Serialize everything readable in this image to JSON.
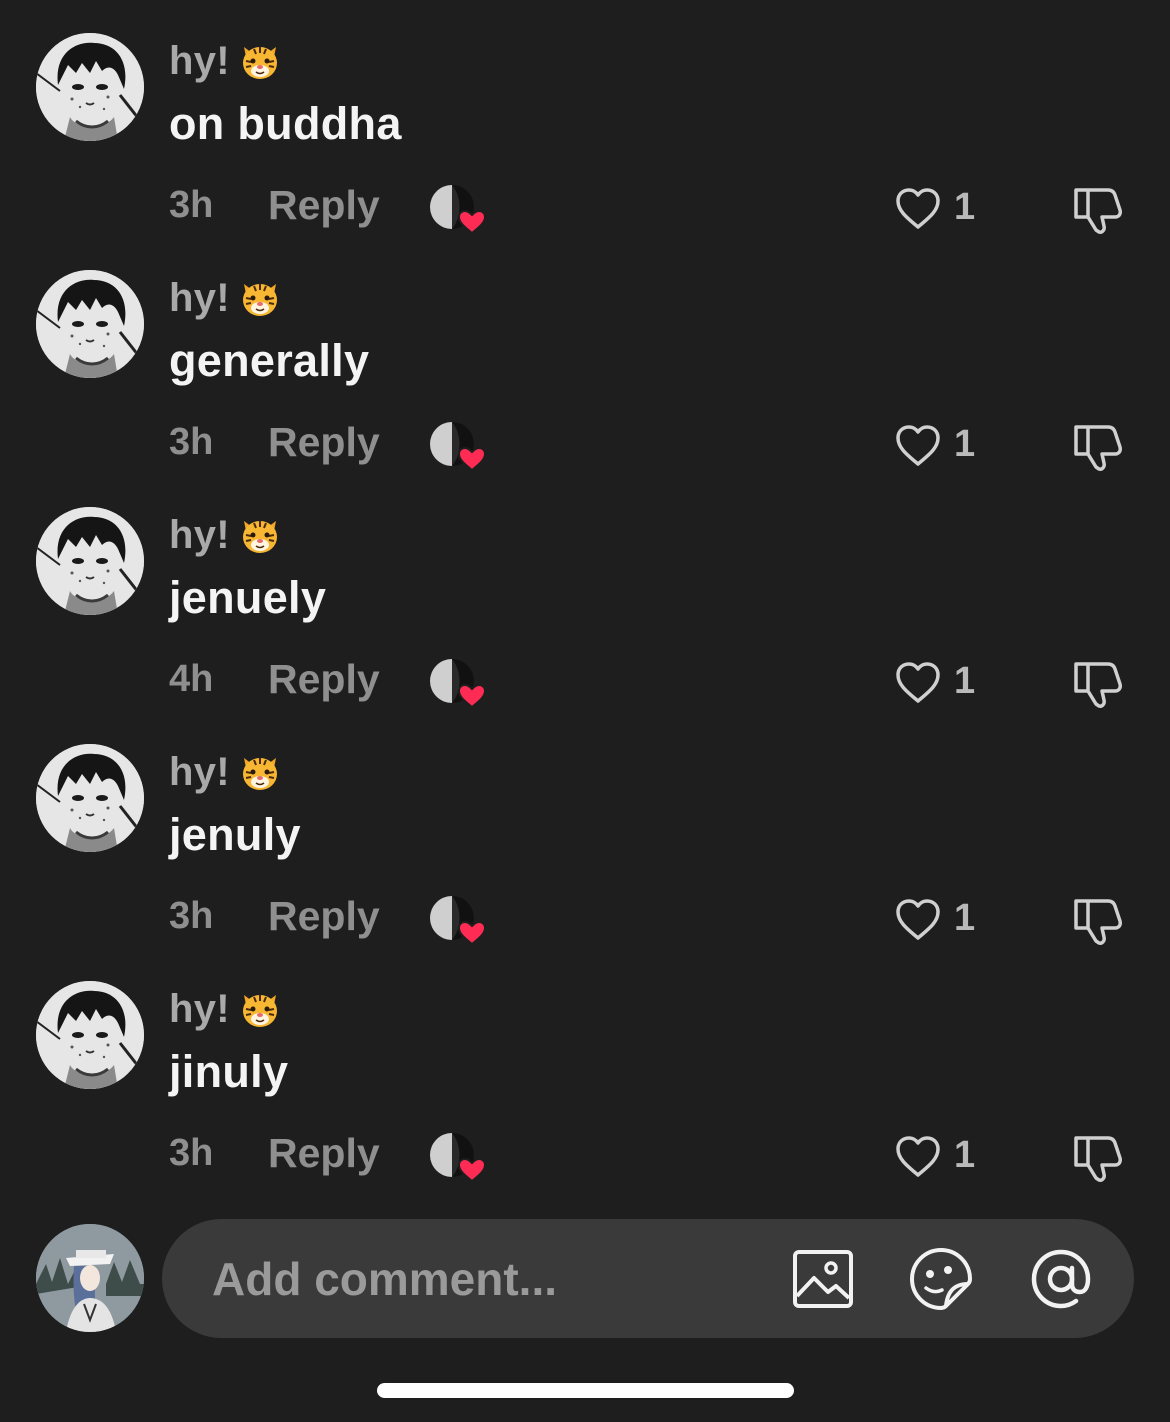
{
  "comments": [
    {
      "username": "hy!",
      "text": "on buddha",
      "time": "3h",
      "reply_label": "Reply",
      "likes": "1"
    },
    {
      "username": "hy!",
      "text": "generally",
      "time": "3h",
      "reply_label": "Reply",
      "likes": "1"
    },
    {
      "username": "hy!",
      "text": "jenuely",
      "time": "4h",
      "reply_label": "Reply",
      "likes": "1"
    },
    {
      "username": "hy!",
      "text": "jenuly",
      "time": "3h",
      "reply_label": "Reply",
      "likes": "1"
    },
    {
      "username": "hy!",
      "text": "jinuly",
      "time": "3h",
      "reply_label": "Reply",
      "likes": "1"
    }
  ],
  "composer": {
    "placeholder": "Add comment...",
    "icons": [
      "image-icon",
      "sticker-icon",
      "mention-icon"
    ]
  },
  "icons": {
    "username_badge": "tiger-face-emoji",
    "creator_liked": "creator-liked-heart-icon",
    "like": "heart-outline-icon",
    "dislike": "thumbs-down-icon"
  },
  "colors": {
    "background": "#1e1e1e",
    "composer_background": "#3a3a3a",
    "liked_heart": "#fe2c55",
    "muted_text": "#8f8f8f"
  }
}
